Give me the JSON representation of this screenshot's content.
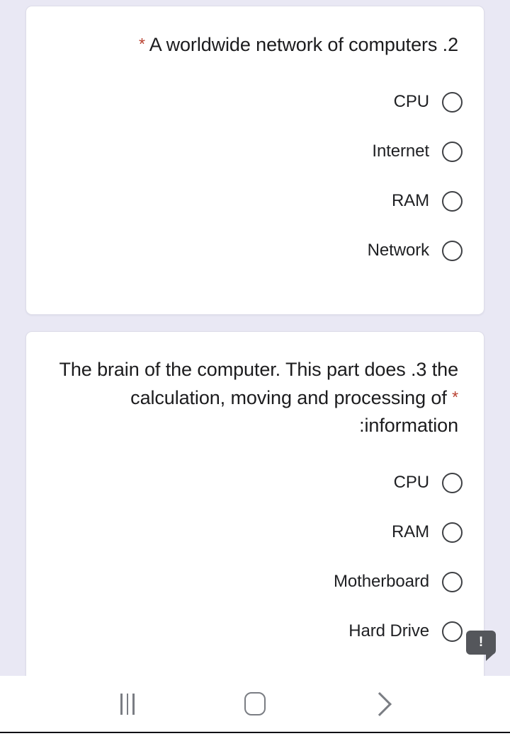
{
  "theme": {
    "background": "#e9e8f4",
    "card_background": "#ffffff",
    "required_star_color": "#b8402f",
    "radio_border_color": "#3f4145",
    "text_color": "#1c1c1e",
    "nav_icon_color": "#7a7d83",
    "warning_bubble_color": "#54565b"
  },
  "questions": [
    {
      "number": "2",
      "text": "A worldwide network of computers .2",
      "required": true,
      "required_marker": "*",
      "options": [
        {
          "label": "CPU",
          "selected": false
        },
        {
          "label": "Internet",
          "selected": false
        },
        {
          "label": "RAM",
          "selected": false
        },
        {
          "label": "Network",
          "selected": false
        }
      ]
    },
    {
      "number": "3",
      "text": "The brain of the computer. This part does .3 the calculation, moving and processing of :information",
      "text_line1": "The brain of the computer. This part does .3",
      "text_line2": "the calculation, moving and processing of",
      "text_line3": ":information",
      "required": true,
      "required_marker": "*",
      "options": [
        {
          "label": "CPU",
          "selected": false
        },
        {
          "label": "RAM",
          "selected": false
        },
        {
          "label": "Motherboard",
          "selected": false
        },
        {
          "label": "Hard Drive",
          "selected": false
        }
      ]
    }
  ],
  "warning": {
    "icon": "exclamation-icon",
    "glyph": "!"
  },
  "navigation": {
    "recents_label": "Recents",
    "home_label": "Home",
    "back_label": "Back"
  }
}
